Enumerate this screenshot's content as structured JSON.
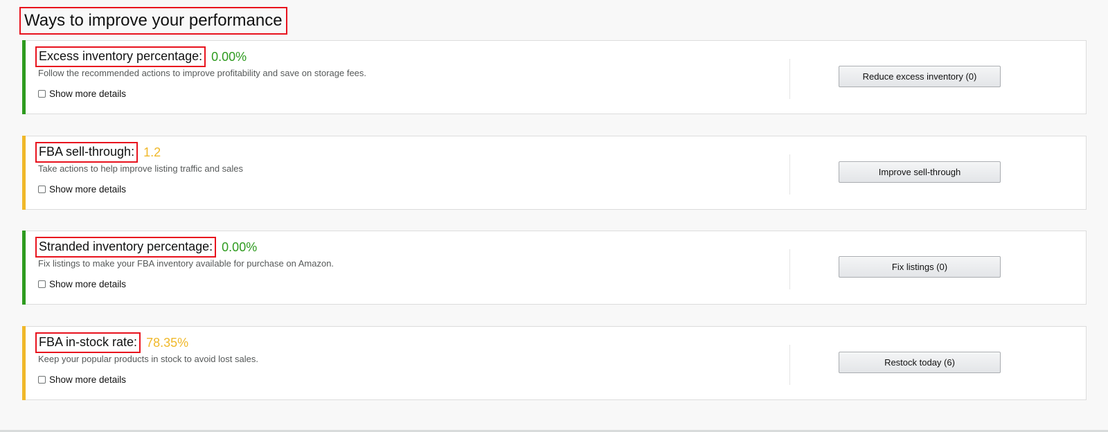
{
  "page": {
    "title": "Ways to improve your performance"
  },
  "colors": {
    "green": "#2e9b1f",
    "yellow": "#f0b82a",
    "highlight": "#e8121d"
  },
  "cards": [
    {
      "heading": "Excess inventory percentage:",
      "metric": "0.00%",
      "status": "green",
      "description": "Follow the recommended actions to improve profitability and save on storage fees.",
      "details_label": "Show more details",
      "button_label": "Reduce excess inventory (0)"
    },
    {
      "heading": "FBA sell-through:",
      "metric": "1.2",
      "status": "yellow",
      "description": "Take actions to help improve listing traffic and sales",
      "details_label": "Show more details",
      "button_label": "Improve sell-through"
    },
    {
      "heading": "Stranded inventory percentage:",
      "metric": "0.00%",
      "status": "green",
      "description": "Fix listings to make your FBA inventory available for purchase on Amazon.",
      "details_label": "Show more details",
      "button_label": "Fix listings (0)"
    },
    {
      "heading": "FBA in-stock rate:",
      "metric": "78.35%",
      "status": "yellow",
      "description": "Keep your popular products in stock to avoid lost sales.",
      "details_label": "Show more details",
      "button_label": "Restock today (6)"
    }
  ]
}
